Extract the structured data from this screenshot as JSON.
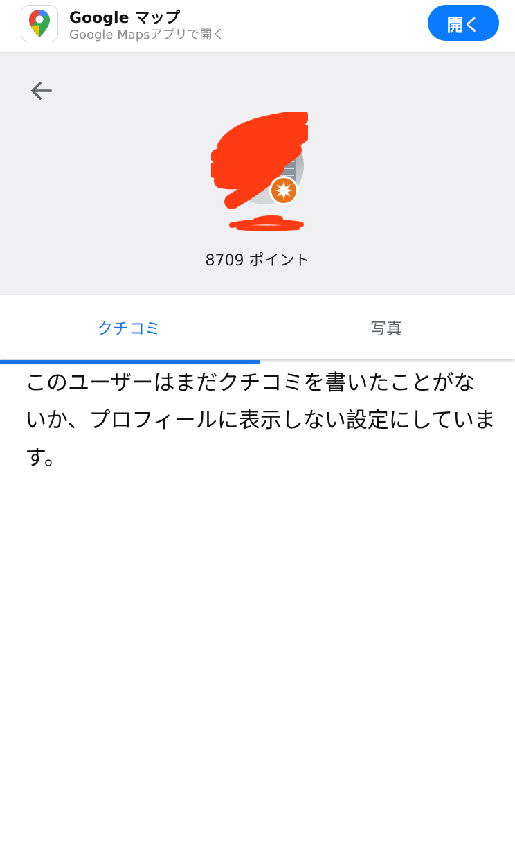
{
  "app_banner": {
    "title": "Google マップ",
    "subtitle": "Google Mapsアプリで開く",
    "open_label": "開く",
    "icon": "google-maps-pin-icon"
  },
  "profile": {
    "points_label": "8709 ポイント",
    "badge_icon": "local-guide-star-icon"
  },
  "tabs": [
    {
      "label": "クチコミ",
      "selected": true
    },
    {
      "label": "写真",
      "selected": false
    }
  ],
  "empty_state": {
    "message": "このユーザーはまだクチコミを書いたことがないか、プロフィールに表示しない設定にしています。"
  },
  "colors": {
    "accent": "#1a73e8",
    "open_button": "#0a7bff",
    "header_bg": "#f0f0f2",
    "badge": "#e8711a",
    "redaction": "#ff3b14"
  }
}
